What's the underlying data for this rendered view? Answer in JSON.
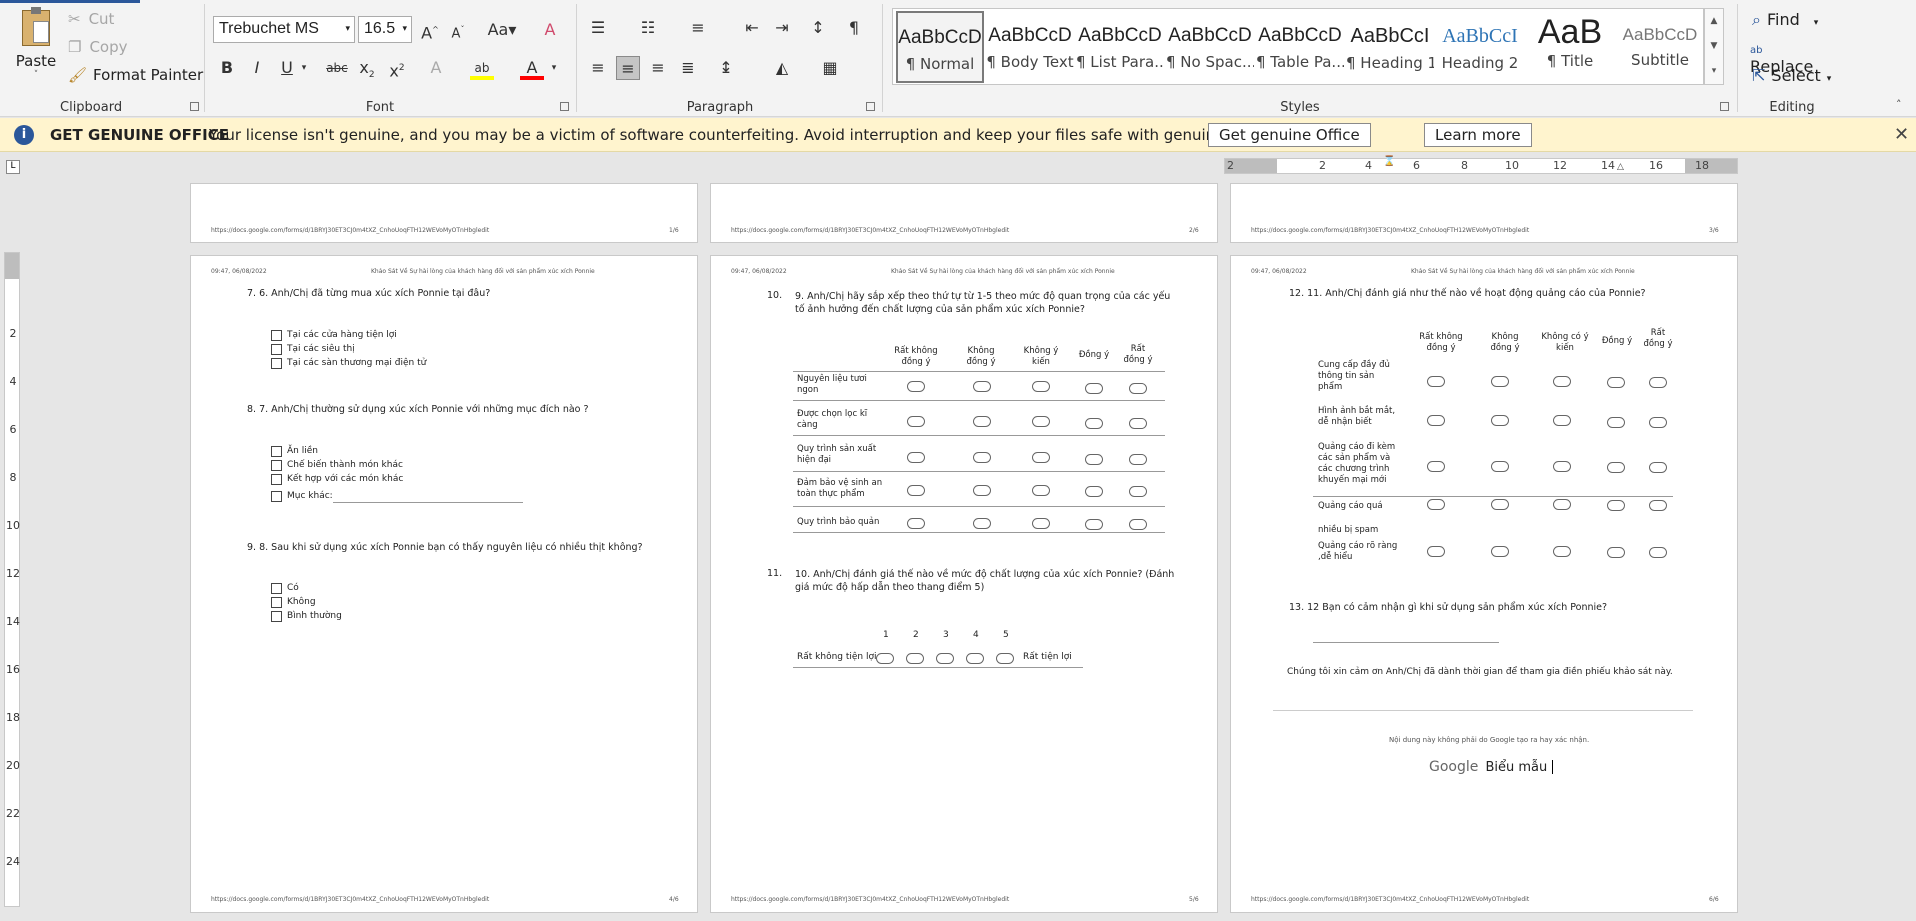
{
  "clipboard": {
    "paste": "Paste",
    "cut": "Cut",
    "copy": "Copy",
    "format_painter": "Format Painter",
    "group": "Clipboard"
  },
  "font": {
    "name": "Trebuchet MS",
    "size": "16.5",
    "group": "Font"
  },
  "paragraph": {
    "group": "Paragraph"
  },
  "styles": {
    "group": "Styles",
    "items": [
      {
        "preview": "AaBbCcD",
        "name": "¶ Normal"
      },
      {
        "preview": "AaBbCcD",
        "name": "¶ Body Text"
      },
      {
        "preview": "AaBbCcD",
        "name": "¶ List Para..."
      },
      {
        "preview": "AaBbCcD",
        "name": "¶ No Spac..."
      },
      {
        "preview": "AaBbCcD",
        "name": "¶ Table Pa..."
      },
      {
        "preview": "AaBbCcI",
        "name": "¶ Heading 1"
      },
      {
        "preview": "AaBbCcI",
        "name": "Heading 2"
      },
      {
        "preview": "AaB",
        "name": "¶ Title"
      },
      {
        "preview": "AaBbCcD",
        "name": "Subtitle"
      }
    ]
  },
  "editing": {
    "group": "Editing",
    "find": "Find",
    "replace": "Replace",
    "select": "Select"
  },
  "message": {
    "title": "GET GENUINE OFFICE",
    "text": "Your license isn't genuine, and you may be a victim of software counterfeiting. Avoid interruption and keep your files safe with genuine Office today.",
    "btn1": "Get genuine Office",
    "btn2": "Learn more"
  },
  "ruler": {
    "ticks": [
      "2",
      "2",
      "4",
      "6",
      "8",
      "10",
      "12",
      "14",
      "16",
      "18"
    ]
  },
  "vruler": {
    "ticks": [
      "2",
      "4",
      "6",
      "8",
      "10",
      "12",
      "14",
      "16",
      "18",
      "20",
      "22",
      "24"
    ]
  },
  "doc": {
    "url": "https://docs.google.com/forms/d/1BRYJ30ET3CJ0m4tXZ_CnhoUoqFTH12WEVoMyOTnHbgledit",
    "header_time": "09:47, 06/08/2022",
    "header_title": "Khảo Sát Về Sự hài lòng của khách hàng đối với sản phẩm xúc xích Ponnie",
    "p1_num": "1/6",
    "p2_num": "2/6",
    "p3_num": "3/6",
    "p4_num": "4/6",
    "p5_num": "5/6",
    "p6_num": "6/6",
    "p4": {
      "q7": "7.     6. Anh/Chị đã từng mua xúc xích Ponnie tại đâu?",
      "q7_opts": [
        "Tại các cửa hàng tiện lợi",
        "Tại các siêu thị",
        "Tại các sàn thương mại điện tử"
      ],
      "q8": "8.     7.   Anh/Chị thường sử dụng xúc xích Ponnie với những mục đích nào ?",
      "q8_opts": [
        "Ăn liền",
        "Chế biến thành món khác",
        "Kết hợp với các món khác",
        "Mục khác:"
      ],
      "q9": "9.     8.   Sau khi sử dụng xúc xích Ponnie bạn có thấy nguyên liệu có nhiều thịt không?",
      "q9_opts": [
        "Có",
        "Không",
        "Bình thường"
      ]
    },
    "p5": {
      "q10_num": "10.",
      "q10": "9.   Anh/Chị hãy sắp xếp theo thứ tự từ 1-5 theo mức độ quan trọng của các yếu tố ảnh hưởng đến chất lượng của sản phẩm xúc xích Ponnie?",
      "cols": [
        "Rất không đồng ý",
        "Không đồng ý",
        "Không ý kiến",
        "Đồng ý",
        "Rất đồng ý"
      ],
      "rows": [
        "Nguyên liệu tươi ngon",
        "Được chọn lọc kĩ càng",
        "Quy trình sản xuất hiện đại",
        "Đảm bảo vệ sinh an toàn thực phẩm",
        "Quy trình bảo quản"
      ],
      "q11_num": "11.",
      "q11": "10. Anh/Chị đánh giá thế nào về mức độ chất lượng của xúc xích Ponnie? (Đánh giá mức độ hấp dẫn theo thang điểm 5)",
      "scale": [
        "1",
        "2",
        "3",
        "4",
        "5"
      ],
      "scale_low": "Rất không tiện lợi",
      "scale_high": "Rất tiện lợi"
    },
    "p6": {
      "q12": "12.     11. Anh/Chị đánh giá như thế nào về hoạt động quảng cáo của Ponnie?",
      "cols": [
        "Rất không đồng ý",
        "Không đồng ý",
        "Không có ý kiến",
        "Đồng ý",
        "Rất đồng ý"
      ],
      "rows": [
        "Cung cấp đầy đủ thông tin sản phẩm",
        "Hình ảnh bắt mắt, dễ nhận biết",
        "Quảng cáo đi kèm các sản phẩm và các chương trình khuyến mại mới",
        "Quảng cáo quá",
        "nhiều bị spam",
        "Quảng cáo rõ ràng ,dễ hiểu"
      ],
      "q13": "13.     12 Bạn có cảm nhận gì khi sử dụng sản phẩm xúc xích Ponnie?",
      "thanks": "Chúng tôi xin cảm ơn Anh/Chị đã dành thời gian để tham gia điền phiếu khảo sát này.",
      "disclaimer": "Nội dung này không phải do Google tạo ra hay xác nhận.",
      "google": "Google",
      "forms": "Biểu mẫu"
    }
  }
}
